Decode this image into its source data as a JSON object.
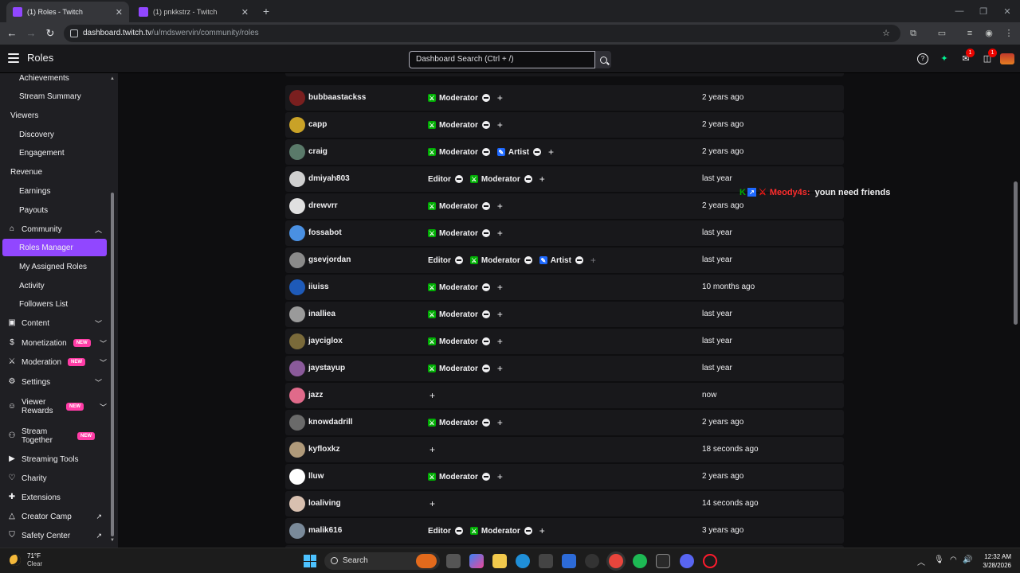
{
  "browser": {
    "tabs": [
      {
        "title": "(1) Roles - Twitch",
        "active": true
      },
      {
        "title": "(1) pnkkstrz - Twitch",
        "active": false
      }
    ],
    "url_domain": "dashboard.twitch.tv",
    "url_path": "/u/mdswervin/community/roles"
  },
  "topnav": {
    "title": "Roles",
    "search_placeholder": "Dashboard Search (Ctrl + /)",
    "notif_inbox": "1",
    "notif_whispers": "1"
  },
  "sidebar": {
    "items": [
      {
        "label": "Achievements",
        "kind": "sub"
      },
      {
        "label": "Stream Summary",
        "kind": "sub"
      },
      {
        "label": "Viewers",
        "kind": "head"
      },
      {
        "label": "Discovery",
        "kind": "sub"
      },
      {
        "label": "Engagement",
        "kind": "sub"
      },
      {
        "label": "Revenue",
        "kind": "head"
      },
      {
        "label": "Earnings",
        "kind": "sub"
      },
      {
        "label": "Payouts",
        "kind": "sub"
      },
      {
        "label": "Community",
        "kind": "section"
      },
      {
        "label": "Roles Manager",
        "kind": "active"
      },
      {
        "label": "My Assigned Roles",
        "kind": "sub"
      },
      {
        "label": "Activity",
        "kind": "sub"
      },
      {
        "label": "Followers List",
        "kind": "sub"
      },
      {
        "label": "Content",
        "kind": "section"
      },
      {
        "label": "Monetization",
        "kind": "section"
      },
      {
        "label": "Moderation",
        "kind": "section"
      },
      {
        "label": "Settings",
        "kind": "section"
      },
      {
        "label": "Viewer Rewards",
        "kind": "section"
      },
      {
        "label": "Stream Together",
        "kind": "section"
      },
      {
        "label": "Streaming Tools",
        "kind": "section"
      },
      {
        "label": "Charity",
        "kind": "section"
      },
      {
        "label": "Extensions",
        "kind": "section"
      },
      {
        "label": "Creator Camp",
        "kind": "section"
      },
      {
        "label": "Safety Center",
        "kind": "section"
      }
    ],
    "new_badge": "NEW"
  },
  "roles_list": {
    "role_names": {
      "editor": "Editor",
      "moderator": "Moderator",
      "artist": "Artist"
    },
    "rows": [
      {
        "user": "bubbaastackss",
        "when": "2 years ago",
        "avatar_color": "#7a1f1f"
      },
      {
        "user": "capp",
        "when": "2 years ago",
        "avatar_color": "#c9a227"
      },
      {
        "user": "craig",
        "when": "2 years ago",
        "avatar_color": "#5a7a6a"
      },
      {
        "user": "dmiyah803",
        "when": "last year",
        "avatar_color": "#d0d0d0"
      },
      {
        "user": "drewvrr",
        "when": "2 years ago",
        "avatar_color": "#e0e0e0"
      },
      {
        "user": "fossabot",
        "when": "last year",
        "avatar_color": "#4a90e2"
      },
      {
        "user": "gsevjordan",
        "when": "last year",
        "avatar_color": "#8a8a8a"
      },
      {
        "user": "iiuiss",
        "when": "10 months ago",
        "avatar_color": "#1e5ab8"
      },
      {
        "user": "inalliea",
        "when": "last year",
        "avatar_color": "#9a9a9a"
      },
      {
        "user": "jayciglox",
        "when": "last year",
        "avatar_color": "#7a6a3a"
      },
      {
        "user": "jaystayup",
        "when": "last year",
        "avatar_color": "#8a5a9a"
      },
      {
        "user": "jazz",
        "when": "now",
        "avatar_color": "#e06a8a"
      },
      {
        "user": "knowdadrill",
        "when": "2 years ago",
        "avatar_color": "#6a6a6a"
      },
      {
        "user": "kyfloxkz",
        "when": "18 seconds ago",
        "avatar_color": "#b09a7a"
      },
      {
        "user": "lluw",
        "when": "2 years ago",
        "avatar_color": "#ffffff"
      },
      {
        "user": "loaliving",
        "when": "14 seconds ago",
        "avatar_color": "#d8c0b0"
      },
      {
        "user": "malik616",
        "when": "3 years ago",
        "avatar_color": "#7a8a9a"
      }
    ]
  },
  "overlay": {
    "username": "Meody4s:",
    "message": "youn need friends"
  },
  "taskbar": {
    "temp": "71°F",
    "condition": "Clear",
    "search_label": "Search",
    "time": "12:32 AM",
    "date": "3/28/2026"
  },
  "colors": {
    "accent": "#9147ff",
    "moderator": "#00ad03",
    "artist": "#1e69ff",
    "new_badge": "#ff3ca6"
  }
}
